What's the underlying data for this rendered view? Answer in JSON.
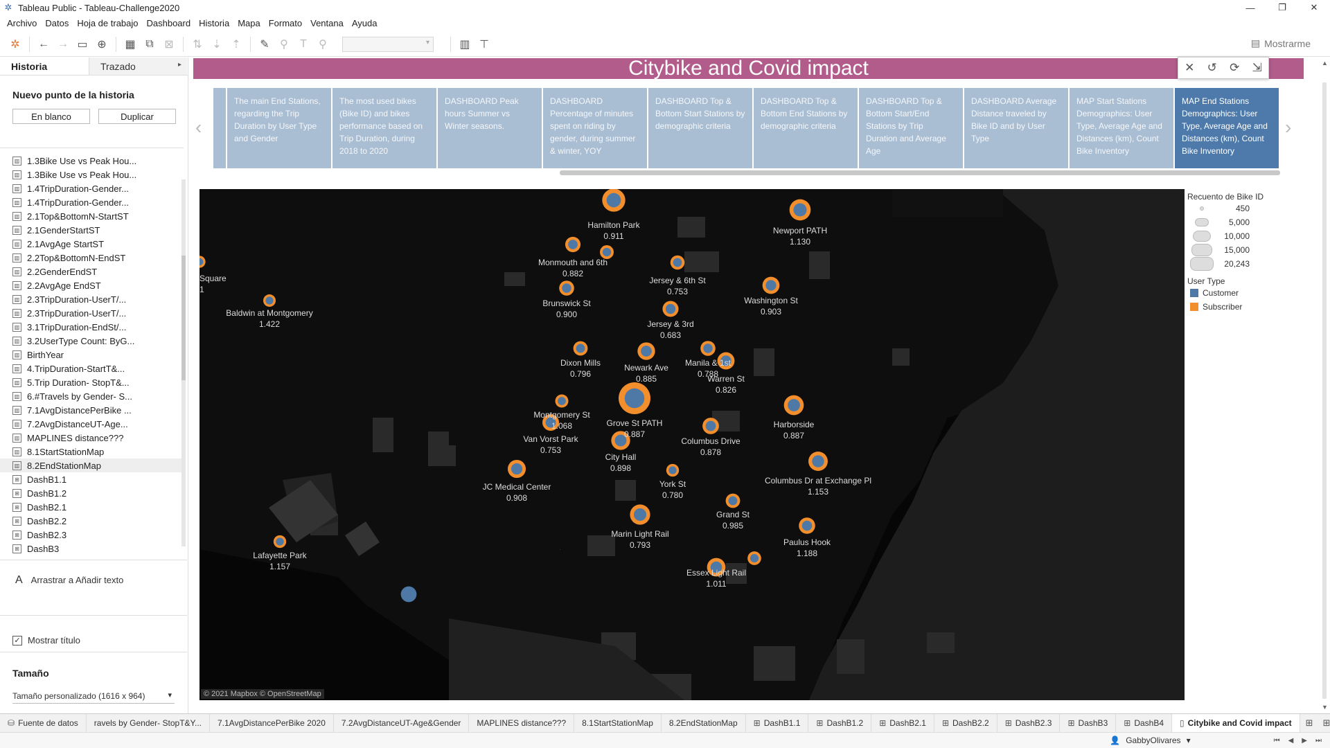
{
  "window": {
    "title": "Tableau Public - Tableau-Challenge2020"
  },
  "menu": [
    "Archivo",
    "Datos",
    "Hoja de trabajo",
    "Dashboard",
    "Historia",
    "Mapa",
    "Formato",
    "Ventana",
    "Ayuda"
  ],
  "toolbar": {
    "show_me": "Mostrarme"
  },
  "sidebar": {
    "tab_historia": "Historia",
    "tab_trazado": "Trazado",
    "new_point_heading": "Nuevo punto de la historia",
    "blank_button": "En blanco",
    "duplicate_button": "Duplicar",
    "sheets": [
      "1.3Bike Use vs Peak Hou...",
      "1.3Bike Use vs Peak Hou...",
      "1.4TripDuration-Gender...",
      "1.4TripDuration-Gender...",
      "2.1Top&BottomN-StartST",
      "2.1GenderStartST",
      "2.1AvgAge StartST",
      "2.2Top&BottomN-EndST",
      "2.2GenderEndST",
      "2.2AvgAge EndST",
      "2.3TripDuration-UserT/...",
      "2.3TripDuration-UserT/...",
      "3.1TripDuration-EndSt/...",
      "3.2UserType Count: ByG...",
      "BirthYear",
      "4.TripDuration-StartT&...",
      "5.Trip Duration- StopT&...",
      "6.#Travels by Gender- S...",
      "7.1AvgDistancePerBike ...",
      "7.2AvgDistanceUT-Age...",
      "MAPLINES distance???",
      "8.1StartStationMap",
      "8.2EndStationMap",
      "DashB1.1",
      "DashB1.2",
      "DashB2.1",
      "DashB2.2",
      "DashB2.3",
      "DashB3"
    ],
    "drag_text": "Arrastrar a Añadir texto",
    "show_title": "Mostrar título",
    "size_heading": "Tamaño",
    "size_value": "Tamaño personalizado (1616 x 964)"
  },
  "story": {
    "title": "Citybike and Covid impact",
    "points": [
      "The main End Stations, regarding the Trip Duration by User Type and Gender",
      "The most used bikes (Bike ID) and bikes performance based on Trip Duration, during 2018 to 2020",
      "DASHBOARD Peak hours Summer vs Winter seasons.",
      "DASHBOARD Percentage of minutes spent on riding by gender, during summer & winter, YOY",
      "DASHBOARD Top & Bottom Start Stations by demographic criteria",
      "DASHBOARD Top & Bottom End Stations by demographic criteria",
      "DASHBOARD  Top & Bottom Start/End Stations by Trip Duration and Average Age",
      "DASHBOARD Average Distance traveled by Bike ID and by User Type",
      "MAP Start Stations Demographics: User Type, Average Age and Distances (km), Count Bike Inventory",
      "MAP End Stations Demographics: User Type, Average Age and Distances (km), Count Bike Inventory"
    ]
  },
  "map": {
    "attribution": "© 2021 Mapbox © OpenStreetMap",
    "stations": [
      {
        "name": "Hamilton Park",
        "value": "0.911",
        "count": 9000
      },
      {
        "name": "Newport PATH",
        "value": "1.130",
        "count": 7200
      },
      {
        "name": "Monmouth and 6th",
        "value": "0.882",
        "count": 2800
      },
      {
        "name": "",
        "value": "",
        "count": 2000
      },
      {
        "name": "Jersey & 6th St",
        "value": "0.753",
        "count": 2200
      },
      {
        "name": "Square",
        "value": "1",
        "count": 1200
      },
      {
        "name": "Baldwin at Montgomery",
        "value": "1.422",
        "count": 1400
      },
      {
        "name": "Brunswick St",
        "value": "0.900",
        "count": 2600
      },
      {
        "name": "Jersey & 3rd",
        "value": "0.683",
        "count": 3200
      },
      {
        "name": "Washington St",
        "value": "0.903",
        "count": 3900
      },
      {
        "name": "Dixon Mills",
        "value": "0.796",
        "count": 2300
      },
      {
        "name": "Newark Ave",
        "value": "0.885",
        "count": 4200
      },
      {
        "name": "Manila & 1st",
        "value": "0.788",
        "count": 2600
      },
      {
        "name": "Warren St",
        "value": "0.826",
        "count": 4000
      },
      {
        "name": "Montgomery St",
        "value": "1.068",
        "count": 1700
      },
      {
        "name": "Grove St PATH",
        "value": "0.887",
        "count": 20243
      },
      {
        "name": "Harborside",
        "value": "0.887",
        "count": 6000
      },
      {
        "name": "Van Vorst Park",
        "value": "0.753",
        "count": 3600
      },
      {
        "name": "Columbus Drive",
        "value": "0.878",
        "count": 3500
      },
      {
        "name": "City Hall",
        "value": "0.898",
        "count": 5200
      },
      {
        "name": "JC Medical Center",
        "value": "0.908",
        "count": 4600
      },
      {
        "name": "York St",
        "value": "0.780",
        "count": 1500
      },
      {
        "name": "Columbus Dr at Exchange Pl",
        "value": "1.153",
        "count": 5600
      },
      {
        "name": "Grand St",
        "value": "0.985",
        "count": 2300
      },
      {
        "name": "Marin Light Rail",
        "value": "0.793",
        "count": 6300
      },
      {
        "name": "Paulus Hook",
        "value": "1.188",
        "count": 3400
      },
      {
        "name": "Lafayette Park",
        "value": "1.157",
        "count": 1500
      },
      {
        "name": "Essex Light Rail",
        "value": "1.011",
        "count": 4900
      },
      {
        "name": "",
        "value": "",
        "count": 1900
      },
      {
        "name": "",
        "value": "",
        "count": 7000
      }
    ]
  },
  "legend": {
    "size_title": "Recuento de Bike ID",
    "sizes": [
      "450",
      "5,000",
      "10,000",
      "15,000",
      "20,243"
    ],
    "color_title": "User Type",
    "colors": [
      {
        "label": "Customer",
        "color": "#4e79a7"
      },
      {
        "label": "Subscriber",
        "color": "#f28e2b"
      }
    ]
  },
  "tabs": [
    "Fuente de datos",
    "ravels by Gender- StopT&Y...",
    "7.1AvgDistancePerBike 2020",
    "7.2AvgDistanceUT-Age&Gender",
    "MAPLINES distance???",
    "8.1StartStationMap",
    "8.2EndStationMap",
    "DashB1.1",
    "DashB1.2",
    "DashB2.1",
    "DashB2.2",
    "DashB2.3",
    "DashB3",
    "DashB4",
    "Citybike and Covid impact"
  ],
  "status": {
    "user": "GabbyOlivares"
  }
}
